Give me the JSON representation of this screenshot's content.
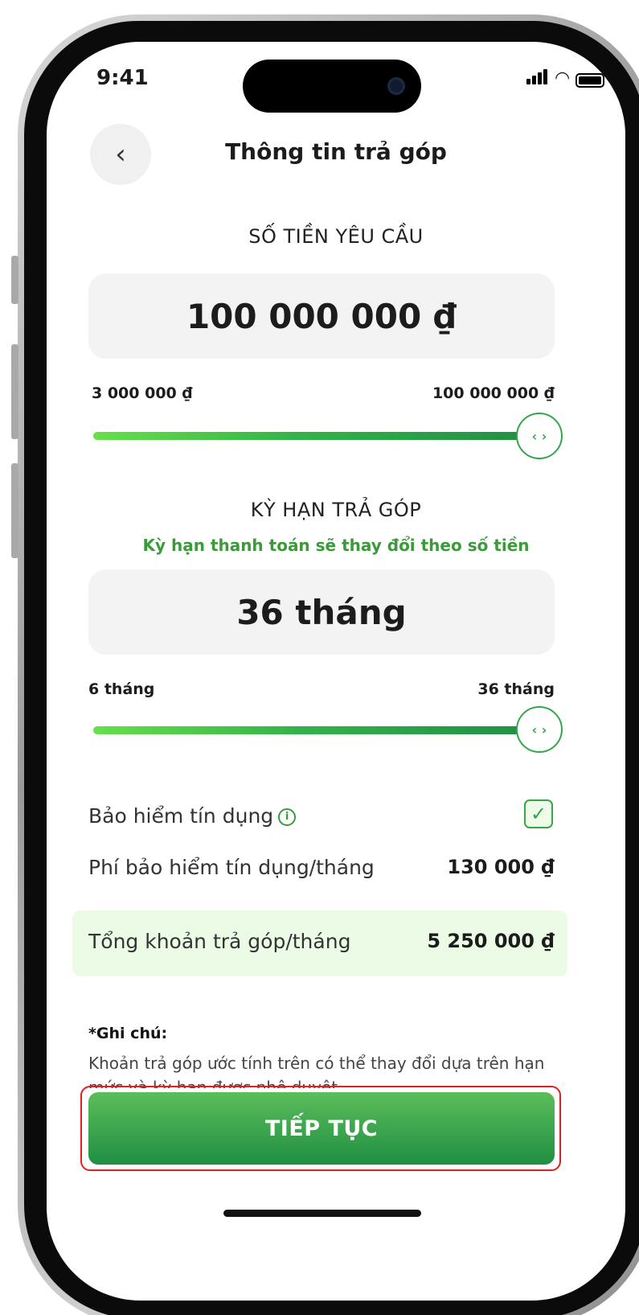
{
  "status_bar": {
    "time": "9:41"
  },
  "header": {
    "back_icon": "chevron-left-icon",
    "title": "Thông tin trả góp"
  },
  "amount": {
    "section_label": "SỐ TIỀN YÊU CẦU",
    "value": "100 000 000 ₫",
    "min_label": "3 000 000 ₫",
    "max_label": "100 000 000 ₫",
    "slider_level_percent": 100,
    "thumb_glyph": "‹ ›"
  },
  "term": {
    "section_label": "KỲ HẠN TRẢ GÓP",
    "hint": "Kỳ hạn thanh toán sẽ thay đổi theo số tiền",
    "value": "36 tháng",
    "min_label": "6 tháng",
    "max_label": "36 tháng",
    "slider_level_percent": 100,
    "thumb_glyph": "‹ ›"
  },
  "insurance": {
    "label": "Bảo hiểm tín dụng",
    "info_glyph": "i",
    "checked": true,
    "check_glyph": "✓",
    "fee_label": "Phí bảo hiểm tín dụng/tháng",
    "fee_value": "130 000 ₫"
  },
  "total": {
    "label": "Tổng khoản trả góp/tháng",
    "value": "5 250 000 ₫"
  },
  "note": {
    "title": "*Ghi chú:",
    "text": "Khoản trả góp ước tính trên có thể thay đổi dựa trên hạn mức và kỳ hạn được phê duyệt."
  },
  "cta": {
    "label": "TIẾP TỤC"
  },
  "colors": {
    "accent": "#35a64a",
    "cta_frame": "#e02020",
    "total_panel": "#ebfbe6"
  }
}
